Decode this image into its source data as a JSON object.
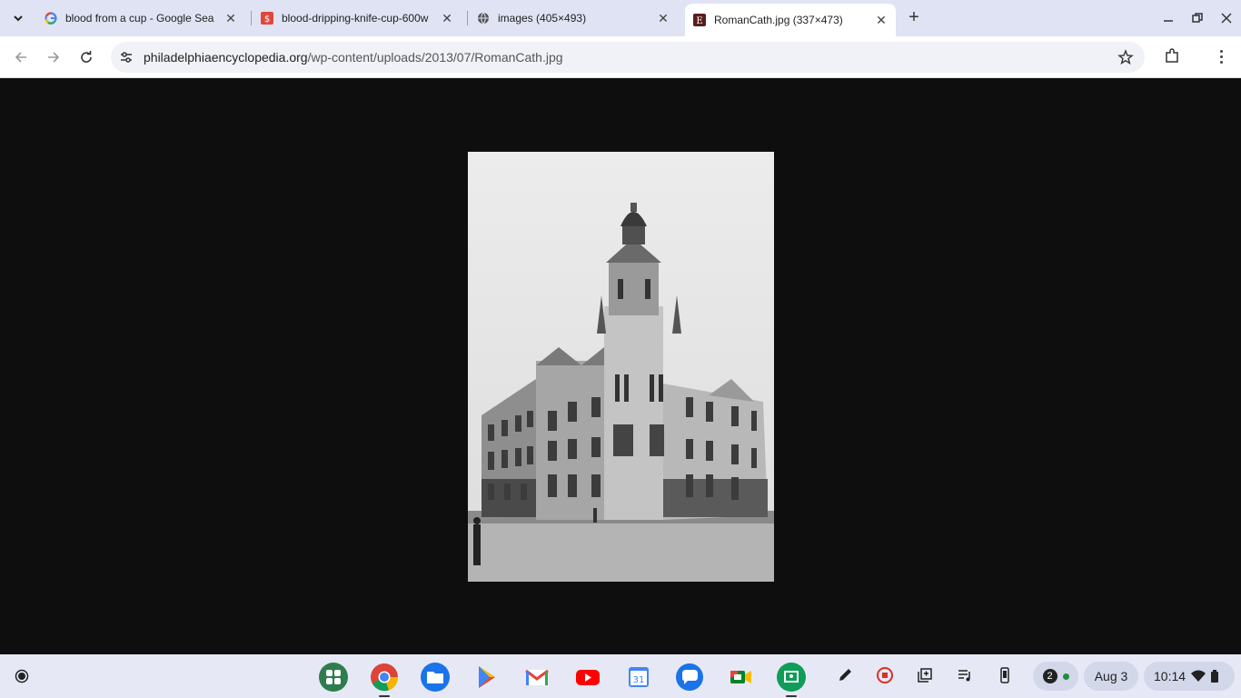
{
  "tabs": [
    {
      "title": "blood from a cup - Google Sea",
      "favicon": "google-icon"
    },
    {
      "title": "blood-dripping-knife-cup-600w",
      "favicon": "site-red-icon"
    },
    {
      "title": "images (405×493)",
      "favicon": "globe-icon"
    },
    {
      "title": "RomanCath.jpg (337×473)",
      "favicon": "site-dark-icon"
    }
  ],
  "address_bar": {
    "host": "philadelphiaencyclopedia.org",
    "path": "/wp-content/uploads/2013/07/RomanCath.jpg"
  },
  "shelf": {
    "notification_count": "2",
    "date": "Aug 3",
    "time": "10:14"
  },
  "colors": {
    "tabstrip": "#dfe3f3",
    "viewport": "#0e0e0e",
    "shelf": "#e6e9f5"
  }
}
